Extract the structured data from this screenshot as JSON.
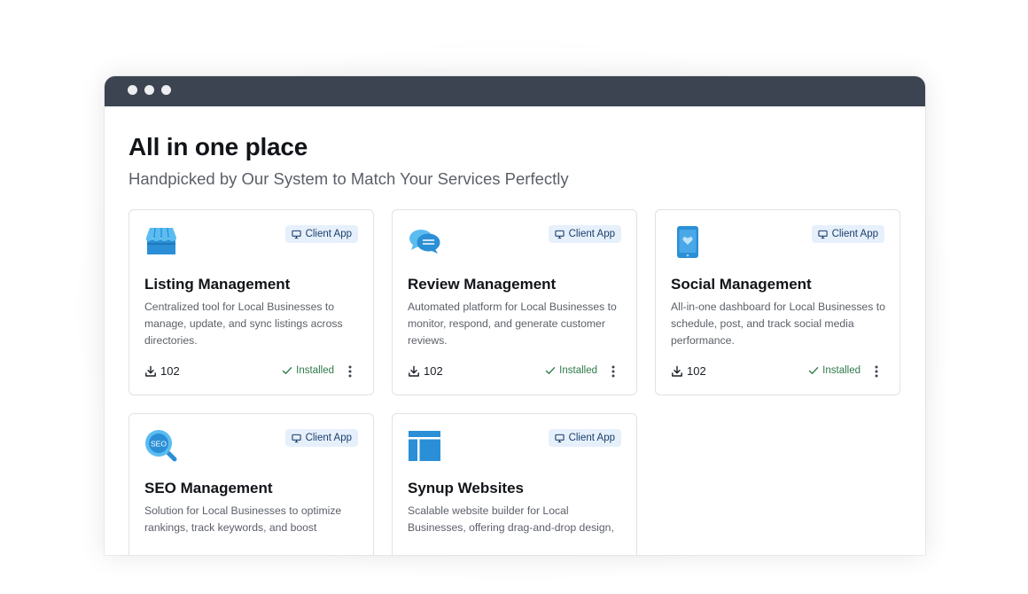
{
  "header": {
    "title": "All in one place",
    "subtitle": "Handpicked by Our System to Match Your Services Perfectly"
  },
  "colors": {
    "titlebar": "#3b4450",
    "icon_blue": "#2a8fd6",
    "badge_bg": "#e6f0fb",
    "installed_green": "#2d7a4a"
  },
  "cards": [
    {
      "icon": "storefront-icon",
      "badge": "Client App",
      "title": "Listing Management",
      "description": "Centralized tool for Local Businesses to manage, update, and sync listings across directories.",
      "downloads": "102",
      "status": "Installed"
    },
    {
      "icon": "chat-bubbles-icon",
      "badge": "Client App",
      "title": "Review Management",
      "description": "Automated platform for Local Businesses to monitor, respond, and generate customer reviews.",
      "downloads": "102",
      "status": "Installed"
    },
    {
      "icon": "phone-heart-icon",
      "badge": "Client App",
      "title": "Social Management",
      "description": "All-in-one dashboard for Local Businesses to schedule, post, and track social media performance.",
      "downloads": "102",
      "status": "Installed"
    },
    {
      "icon": "seo-magnifier-icon",
      "icon_text": "SEO",
      "badge": "Client App",
      "title": "SEO Management",
      "description": "Solution for Local Businesses to optimize rankings, track keywords, and boost"
    },
    {
      "icon": "website-layout-icon",
      "badge": "Client App",
      "title": "Synup Websites",
      "description": "Scalable website builder for Local Businesses, offering drag-and-drop design,"
    }
  ]
}
